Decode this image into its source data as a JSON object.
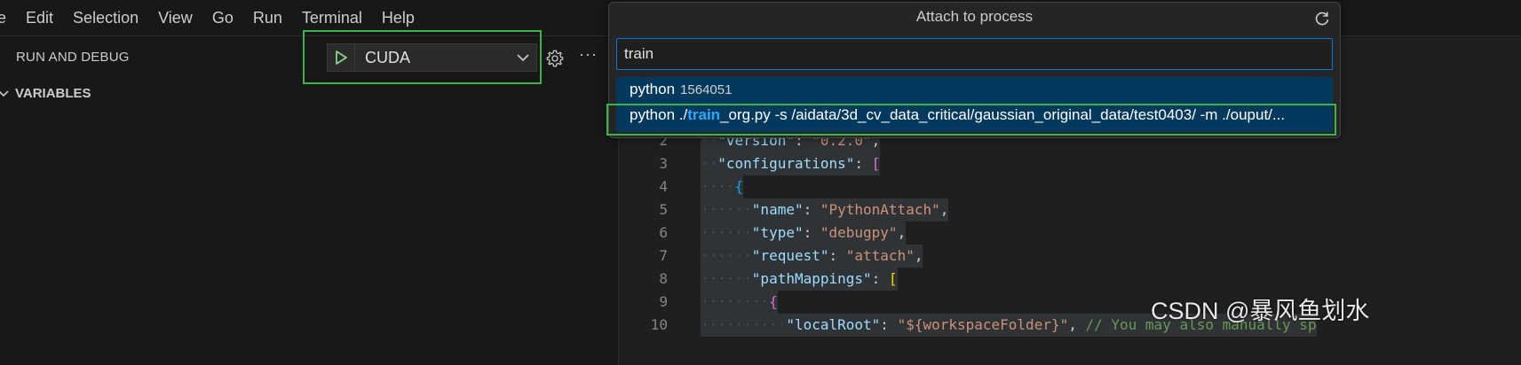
{
  "menubar": {
    "items": [
      "e",
      "Edit",
      "Selection",
      "View",
      "Go",
      "Run",
      "Terminal",
      "Help"
    ]
  },
  "sidebar": {
    "title": "RUN AND DEBUG",
    "launch_config": "CUDA",
    "more_label": "···",
    "variables_label": "VARIABLES"
  },
  "quick_pick": {
    "title": "Attach to process",
    "input_value": "train",
    "items": [
      {
        "name": "python",
        "pid": "1564051"
      },
      {
        "prefix": "python ./",
        "match": "train",
        "suffix": "_org.py -s /aidata/3d_cv_data_critical/gaussian_original_data/test0403/ -m ./ouput/..."
      }
    ]
  },
  "editor": {
    "lines": [
      {
        "num": "2",
        "ws": "··",
        "tokens": [
          [
            "k",
            "\"version\""
          ],
          [
            "p",
            ": "
          ],
          [
            "s",
            "\"0.2.0\""
          ],
          [
            "p",
            ","
          ]
        ]
      },
      {
        "num": "3",
        "ws": "··",
        "tokens": [
          [
            "k",
            "\"configurations\""
          ],
          [
            "p",
            ": "
          ],
          [
            "b2",
            "["
          ]
        ]
      },
      {
        "num": "4",
        "ws": "····",
        "tokens": [
          [
            "b3",
            "{"
          ]
        ]
      },
      {
        "num": "5",
        "ws": "······",
        "tokens": [
          [
            "k",
            "\"name\""
          ],
          [
            "p",
            ": "
          ],
          [
            "s",
            "\"PythonAttach\""
          ],
          [
            "p",
            ","
          ]
        ]
      },
      {
        "num": "6",
        "ws": "······",
        "tokens": [
          [
            "k",
            "\"type\""
          ],
          [
            "p",
            ": "
          ],
          [
            "s",
            "\"debugpy\""
          ],
          [
            "p",
            ","
          ]
        ]
      },
      {
        "num": "7",
        "ws": "······",
        "tokens": [
          [
            "k",
            "\"request\""
          ],
          [
            "p",
            ": "
          ],
          [
            "s",
            "\"attach\""
          ],
          [
            "p",
            ","
          ]
        ]
      },
      {
        "num": "8",
        "ws": "······",
        "tokens": [
          [
            "k",
            "\"pathMappings\""
          ],
          [
            "p",
            ": "
          ],
          [
            "b1",
            "["
          ]
        ]
      },
      {
        "num": "9",
        "ws": "········",
        "tokens": [
          [
            "b2",
            "{"
          ]
        ]
      },
      {
        "num": "10",
        "ws": "··········",
        "tokens": [
          [
            "k",
            "\"localRoot\""
          ],
          [
            "p",
            ": "
          ],
          [
            "s",
            "\"${workspaceFolder}\""
          ],
          [
            "p",
            ", "
          ],
          [
            "cm",
            "// You may also manually sp"
          ]
        ]
      }
    ]
  },
  "watermark": "CSDN @暴风鱼划水",
  "colors": {
    "accent_blue": "#0078d4",
    "selection_bg": "#04395e",
    "highlight_green": "#3cb44a",
    "play_green": "#89d185"
  }
}
